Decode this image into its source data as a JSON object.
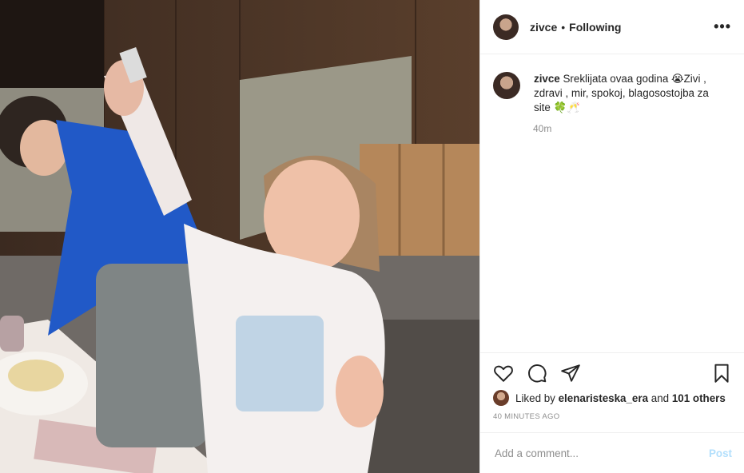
{
  "post": {
    "username": "zivce",
    "separator": "•",
    "follow_state": "Following",
    "more_icon": "more-horizontal-icon"
  },
  "caption": {
    "username": "zivce",
    "text": "Sreklijata ovaa godina 😭Zivi , zdravi , mir, spokoj, blagosostojba za site 🍀🥂",
    "time": "40m"
  },
  "actions": {
    "like_icon": "heart-icon",
    "comment_icon": "comment-icon",
    "share_icon": "share-icon",
    "save_icon": "bookmark-icon"
  },
  "likes": {
    "prefix": "Liked by",
    "liker": "elenaristeska_era",
    "and": "and",
    "others": "101 others"
  },
  "posted_ago": "40 MINUTES AGO",
  "comment_box": {
    "placeholder": "Add a comment...",
    "post_label": "Post"
  },
  "colors": {
    "text": "#262626",
    "muted": "#8e8e8e",
    "post_disabled": "#b2dffc",
    "border": "#efefef"
  }
}
